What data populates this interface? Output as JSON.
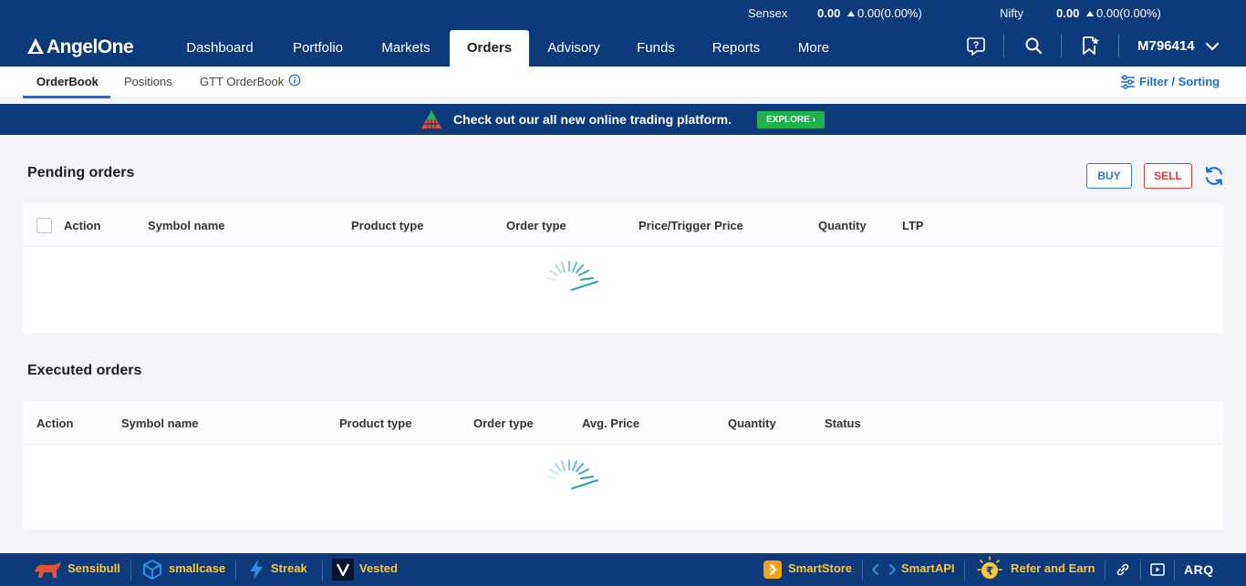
{
  "ticker": {
    "sensex": {
      "name": "Sensex",
      "value": "0.00",
      "change": "0.00(0.00%)"
    },
    "nifty": {
      "name": "Nifty",
      "value": "0.00",
      "change": "0.00(0.00%)"
    }
  },
  "nav": {
    "logo": "AngelOne",
    "items": [
      "Dashboard",
      "Portfolio",
      "Markets",
      "Orders",
      "Advisory",
      "Funds",
      "Reports",
      "More"
    ],
    "active": "Orders",
    "user_id": "M796414",
    "icons": [
      "help-icon",
      "search-icon",
      "watchlist-star-icon",
      "chevron-down-icon"
    ]
  },
  "subtabs": {
    "items": [
      "OrderBook",
      "Positions",
      "GTT OrderBook"
    ],
    "active": "OrderBook",
    "filter_label": "Filter / Sorting"
  },
  "banner": {
    "text": "Check out our all new online trading platform.",
    "cta": "EXPLORE"
  },
  "pending": {
    "title": "Pending orders",
    "buy_label": "BUY",
    "sell_label": "SELL",
    "columns": [
      "Action",
      "Symbol name",
      "Product type",
      "Order type",
      "Price/Trigger Price",
      "Quantity",
      "LTP"
    ]
  },
  "executed": {
    "title": "Executed orders",
    "columns": [
      "Action",
      "Symbol name",
      "Product type",
      "Order type",
      "Avg. Price",
      "Quantity",
      "Status"
    ]
  },
  "footer": {
    "links": [
      "Sensibull",
      "smallcase",
      "Streak",
      "Vested",
      "SmartStore",
      "SmartAPI",
      "Refer and Earn"
    ],
    "brand": "ARQ",
    "colors": {
      "accent": "#ffc72c",
      "navy": "#0c3a7a",
      "link_blue": "#1a6fd1",
      "buy": "#2b7bd6",
      "sell": "#e5383b",
      "explore": "#1fb04d"
    }
  }
}
